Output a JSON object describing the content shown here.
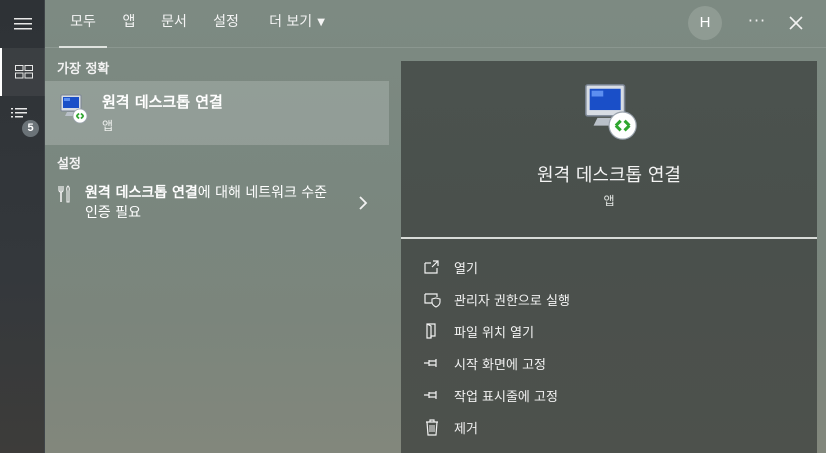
{
  "rail": {
    "badge_count": "5"
  },
  "topbar": {
    "tabs": [
      {
        "label": "모두",
        "active": true
      },
      {
        "label": "앱",
        "active": false
      },
      {
        "label": "문서",
        "active": false
      },
      {
        "label": "설정",
        "active": false
      },
      {
        "label": "더 보기",
        "active": false
      }
    ],
    "avatar_initial": "H",
    "more_label": "···"
  },
  "results": {
    "best_match_header": "가장 정확",
    "best_match": {
      "title": "원격 데스크톱 연결",
      "type": "앱",
      "icon": "remote-desktop-icon"
    },
    "settings_header": "설정",
    "setting_item": {
      "bold_part": "원격 데스크톱 연결",
      "rest": "에 대해 네트워크 수준 인증 필요",
      "icon": "settings-tools-icon"
    }
  },
  "preview": {
    "title": "원격 데스크톱 연결",
    "type": "앱",
    "actions": [
      {
        "label": "열기",
        "icon": "open-icon"
      },
      {
        "label": "관리자 권한으로 실행",
        "icon": "shield-icon"
      },
      {
        "label": "파일 위치 열기",
        "icon": "file-location-icon"
      },
      {
        "label": "시작 화면에 고정",
        "icon": "pin-start-icon"
      },
      {
        "label": "작업 표시줄에 고정",
        "icon": "pin-taskbar-icon"
      },
      {
        "label": "제거",
        "icon": "trash-icon"
      }
    ]
  },
  "colors": {
    "panel_bg": "#7d8a82",
    "preview_bg": "#4b524e",
    "rail_bg": "#2e3236",
    "selected_item_bg": "rgba(255,255,255,0.18)"
  }
}
